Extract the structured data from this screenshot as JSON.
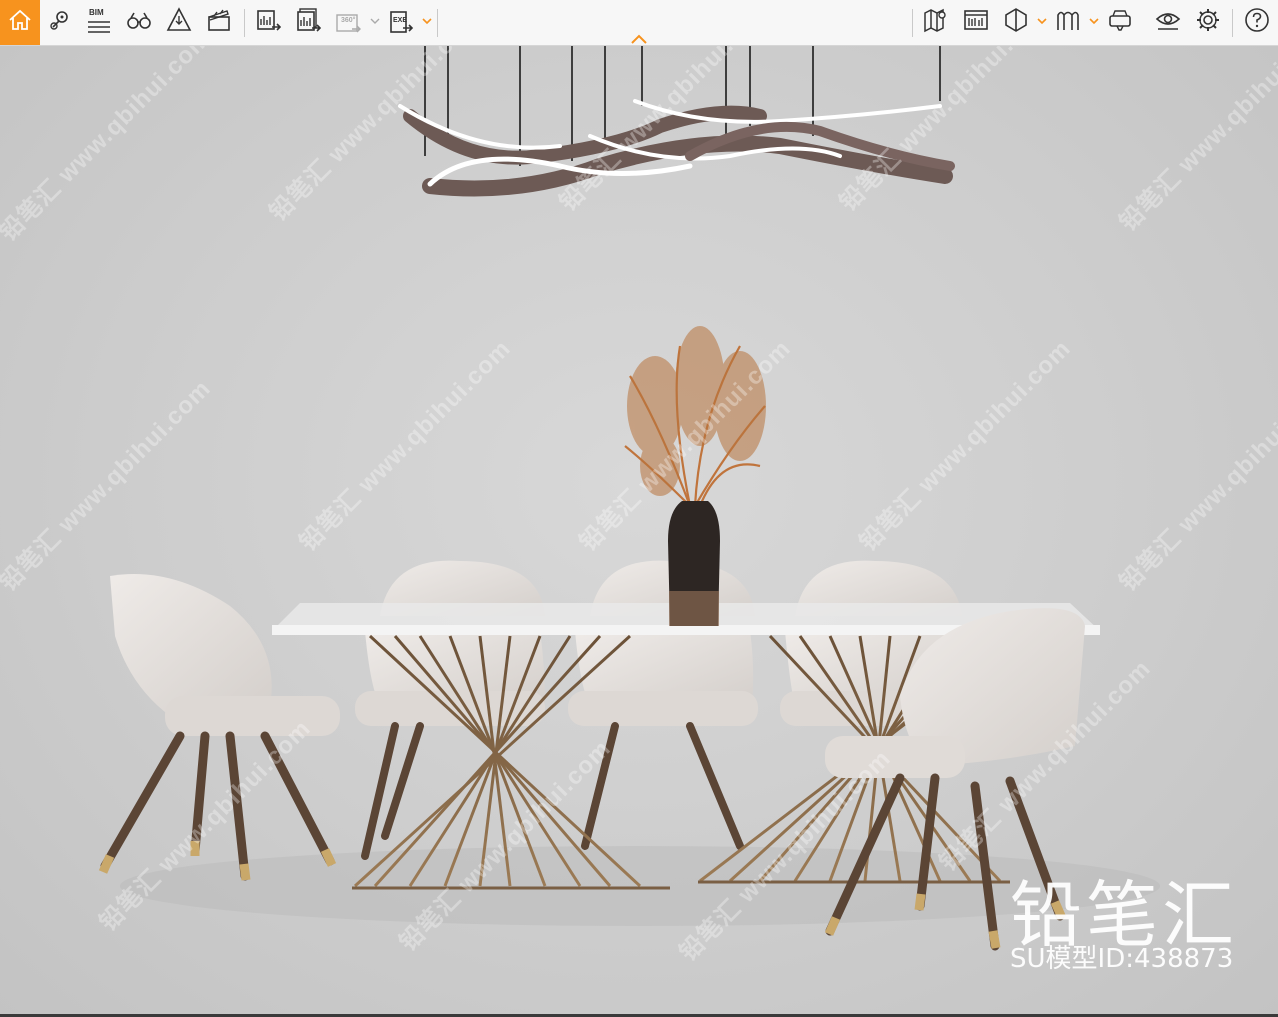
{
  "toolbar": {
    "left_buttons": [
      {
        "name": "home-button",
        "icon": "home-icon"
      },
      {
        "name": "location-button",
        "icon": "location-pin-icon"
      },
      {
        "name": "bim-button",
        "icon": "bim-icon",
        "label": "BIM"
      },
      {
        "name": "binoculars-button",
        "icon": "binoculars-icon"
      },
      {
        "name": "render-button",
        "icon": "triangle-render-icon"
      },
      {
        "name": "animation-button",
        "icon": "clapperboard-icon"
      },
      {
        "name": "export-image-button",
        "icon": "export-image-icon"
      },
      {
        "name": "export-batch-button",
        "icon": "export-batch-icon"
      },
      {
        "name": "panorama-360-button",
        "icon": "panorama-360-icon",
        "label": "360°"
      },
      {
        "name": "export-exe-button",
        "icon": "export-exe-icon",
        "label": "EXE"
      }
    ],
    "right_buttons": [
      {
        "name": "map-button",
        "icon": "map-icon"
      },
      {
        "name": "library-button",
        "icon": "library-icon"
      },
      {
        "name": "material-button",
        "icon": "hexagon-icon"
      },
      {
        "name": "landscape-button",
        "icon": "landscape-icon"
      },
      {
        "name": "vr-button",
        "icon": "vr-headset-icon"
      },
      {
        "name": "view-button",
        "icon": "eye-icon"
      },
      {
        "name": "settings-button",
        "icon": "gear-icon"
      },
      {
        "name": "help-button",
        "icon": "help-icon"
      }
    ],
    "accent_color": "#f7931e"
  },
  "viewport": {
    "watermark_text": "铅笔汇 www.qbihui.com",
    "brand_text": "铅笔汇",
    "model_id_text": "SU模型ID:438873"
  }
}
